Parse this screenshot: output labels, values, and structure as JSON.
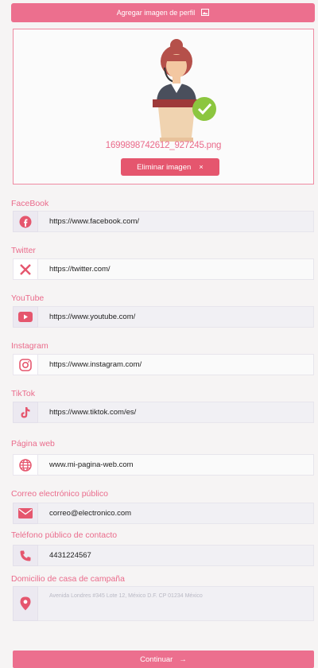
{
  "header": {
    "add_image_label": "Agregar imagen de perfil"
  },
  "image": {
    "filename": "1699898742612_927245.png",
    "delete_label": "Eliminar imagen",
    "delete_x": "×"
  },
  "fields": [
    {
      "label": "FaceBook",
      "value": "https://www.facebook.com/",
      "icon": "facebook-icon"
    },
    {
      "label": "Twitter",
      "value": "https://twitter.com/",
      "icon": "x-twitter-icon"
    },
    {
      "label": "YouTube",
      "value": "https://www.youtube.com/",
      "icon": "youtube-icon"
    },
    {
      "label": "Instagram",
      "value": "https://www.instagram.com/",
      "icon": "instagram-icon"
    },
    {
      "label": "TikTok",
      "value": "https://www.tiktok.com/es/",
      "icon": "tiktok-icon"
    },
    {
      "label": "Página web",
      "value": "www.mi-pagina-web.com",
      "icon": "globe-icon"
    },
    {
      "label": "Correo electrónico público",
      "value": "correo@electronico.com",
      "icon": "mail-icon"
    },
    {
      "label": "Teléfono público de contacto",
      "value": "4431224567",
      "icon": "phone-icon"
    },
    {
      "label": "Domicilio de casa de campaña",
      "placeholder": "Avenida Londres #345 Lote 12, México D.F. CP 01234 México",
      "icon": "location-pin-icon"
    }
  ],
  "footer": {
    "continue_label": "Continuar",
    "arrow": "→"
  },
  "colors": {
    "accent": "#ec6f8e",
    "delete": "#e5566e"
  }
}
